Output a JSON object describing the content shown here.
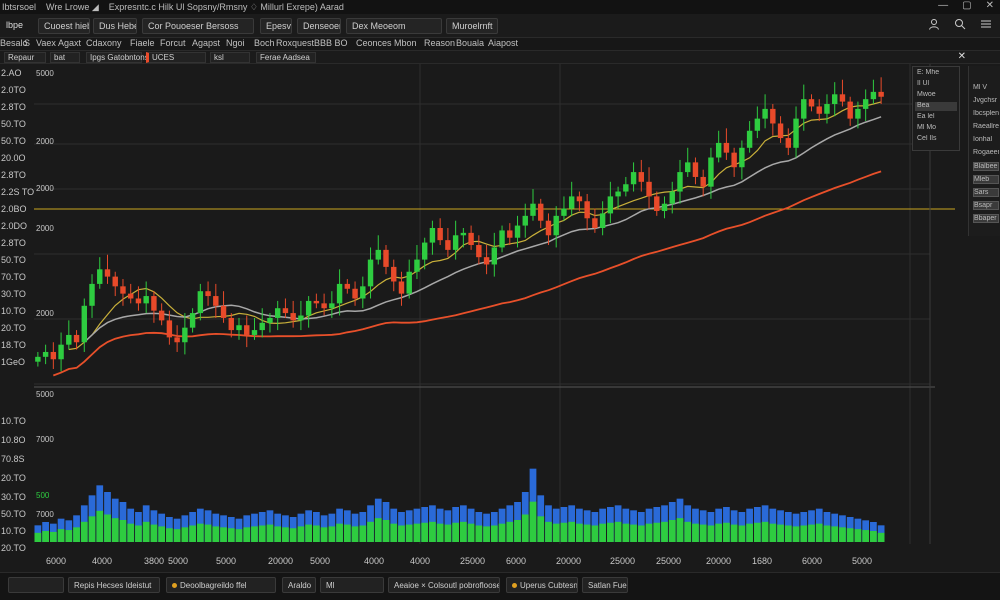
{
  "titlebar": {
    "items": [
      "Ibtsrsoel",
      "Wre Lrowe ◢",
      "Expresntc.c Hilk  Ul  Sopsny/Rmsny ♢  Millurl Exrepe) Aarad"
    ],
    "controls": [
      "—",
      "▢",
      "✕"
    ]
  },
  "toolbar": {
    "logo": "lbpe",
    "items": [
      "Cuoest hiebs",
      "Dus Hebe",
      "Cor Pouoeser Bersoss",
      "Epesv",
      "Denseoeri Edrs",
      "Dex Meoeom",
      "Muroelrnft"
    ],
    "right_icons": [
      "user-icon",
      "search-icon",
      "menu-icon"
    ]
  },
  "menubar": {
    "items": [
      "Besalo",
      "S",
      "Vaex",
      "Agaxt",
      "Cdaxony",
      "Fiaele",
      "Forcut",
      "Agapst",
      "Ngoi",
      "Boch",
      "Roxquest",
      "BBB BO",
      "Ceonces",
      "Mbon",
      "Reason",
      "Bouala",
      "Aiapost"
    ]
  },
  "indicatorbar": {
    "items": [
      "Repaur",
      "bat",
      "Ipgs Gatobntons",
      "UCES",
      "ksl",
      "Ferae Aadsea"
    ],
    "close": "✕"
  },
  "right_panel": {
    "items": [
      "E: Mhe",
      "Il   Ul",
      "Mwoe",
      "Bea",
      "Ea   lel",
      "Ml   Mo",
      "Cel  Ils"
    ]
  },
  "far_panel": {
    "items": [
      "Ml V",
      "Jvgchsr",
      "Ibcsplen",
      "Raeallrer",
      "Ionhal",
      "Rogaeen",
      "Blalbee",
      "Mleb",
      "Sars",
      "Bsapr",
      "Bbaper"
    ]
  },
  "statusbar": {
    "items": [
      "",
      "Repis Hecses  Ideistut",
      "Deoolbagreildo ffel",
      "Araldo",
      "Ml",
      "Aeaioe ×  Colsoutl pobrofloose",
      "Uperus Cubtesny",
      "Satlan Fues"
    ]
  },
  "chart_data": {
    "type": "candlestick",
    "price_axis_labels": [
      "2.AO",
      "2.0TO",
      "2.8TO",
      "50.TO",
      "50.TO",
      "20.0O",
      "2.8TO",
      "2.2S TO",
      "2.0BO",
      "2.0DO",
      "2.8TO",
      "50.TO",
      "70.TO",
      "30.TO",
      "10.TO",
      "20.TO",
      "18.TO",
      "1GeO"
    ],
    "price_inner_labels": [
      "5000",
      "2000",
      "2000",
      "2000",
      "2000",
      "5000"
    ],
    "volume_axis_labels": [
      "10.TO",
      "10.8O",
      "70.8S",
      "20.TO",
      "30.TO",
      "50.TO",
      "10.TO",
      "20.TO"
    ],
    "volume_inner_labels": [
      "7000",
      "500",
      "7000"
    ],
    "x_tick_labels": [
      "6000",
      "4000",
      "3800",
      "5000",
      "5000",
      "20000",
      "5000",
      "4000",
      "4000",
      "25000",
      "6000",
      "20000",
      "25000",
      "25000",
      "20000",
      "1680",
      "6000",
      "5000"
    ],
    "candles_close": [
      22,
      24,
      21,
      27,
      31,
      28,
      43,
      52,
      58,
      55,
      51,
      48,
      46,
      44,
      47,
      41,
      37,
      30,
      28,
      34,
      40,
      49,
      47,
      43,
      38,
      33,
      35,
      31,
      33,
      36,
      38,
      42,
      40,
      37,
      39,
      45,
      44,
      42,
      44,
      52,
      50,
      46,
      51,
      62,
      66,
      59,
      53,
      48,
      57,
      62,
      69,
      75,
      70,
      66,
      72,
      73,
      68,
      63,
      60,
      67,
      74,
      71,
      76,
      80,
      85,
      78,
      72,
      80,
      83,
      88,
      86,
      79,
      75,
      81,
      88,
      90,
      93,
      98,
      94,
      88,
      82,
      85,
      90,
      98,
      102,
      96,
      92,
      104,
      110,
      106,
      100,
      108,
      115,
      120,
      124,
      118,
      112,
      108,
      120,
      128,
      125,
      122,
      126,
      130,
      127,
      120,
      124,
      128,
      131,
      129
    ],
    "price_range": [
      10,
      140
    ],
    "volume": [
      10,
      12,
      11,
      14,
      13,
      16,
      22,
      28,
      34,
      30,
      26,
      24,
      20,
      18,
      22,
      19,
      17,
      15,
      14,
      16,
      18,
      20,
      19,
      17,
      16,
      15,
      14,
      16,
      17,
      18,
      19,
      17,
      16,
      15,
      17,
      19,
      18,
      16,
      17,
      20,
      19,
      17,
      18,
      22,
      26,
      24,
      20,
      18,
      19,
      20,
      21,
      22,
      20,
      19,
      21,
      22,
      20,
      18,
      17,
      18,
      20,
      22,
      24,
      30,
      44,
      28,
      22,
      20,
      21,
      22,
      20,
      19,
      18,
      20,
      21,
      22,
      20,
      19,
      18,
      20,
      21,
      22,
      24,
      26,
      22,
      20,
      19,
      18,
      20,
      21,
      19,
      18,
      20,
      21,
      22,
      20,
      19,
      18,
      17,
      18,
      19,
      20,
      18,
      17,
      16,
      15,
      14,
      13,
      12,
      10
    ],
    "volume_range": [
      0,
      60
    ],
    "colors": {
      "up": "#2ecc40",
      "down": "#e84a2a",
      "ma_fast": "#c9b03a",
      "ma_slow": "#a8a8a8",
      "ma_long": "#e8502a",
      "vol_back": "#2a6ad8",
      "vol_front": "#2ecc40",
      "hline": "#c9a520"
    }
  }
}
